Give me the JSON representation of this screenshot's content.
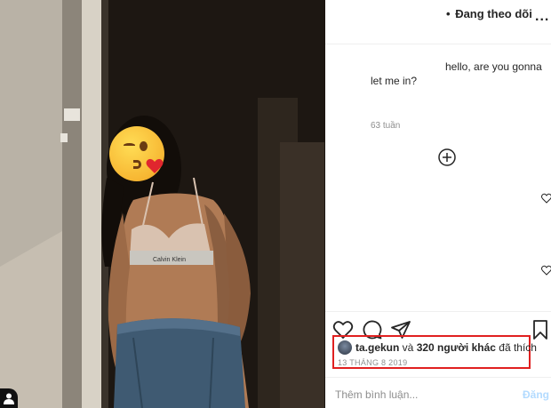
{
  "header": {
    "follow_dot": "•",
    "follow_label": "Đang theo dõi",
    "more_label": "..."
  },
  "comments": {
    "line1": "hello, are you gonna",
    "line2": "let me in?",
    "timestamp": "63 tuần"
  },
  "post": {
    "liked_by_user": "ta.gekun",
    "liked_connector": " và ",
    "liked_others": "320 người khác",
    "liked_suffix": " đã thích",
    "date": "13 THÁNG 8 2019"
  },
  "comment_box": {
    "placeholder": "Thêm bình luận...",
    "post_label": "Đăng"
  },
  "icons": {
    "like": "heart-outline-icon",
    "comment": "speech-bubble-icon",
    "share": "paper-plane-icon",
    "save": "bookmark-icon",
    "load_more": "plus-circle-icon",
    "profile_corner": "person-icon"
  },
  "colors": {
    "highlight_box": "#e02020",
    "post_button": "#b3dbff",
    "muted_text": "#8e8e8e"
  }
}
